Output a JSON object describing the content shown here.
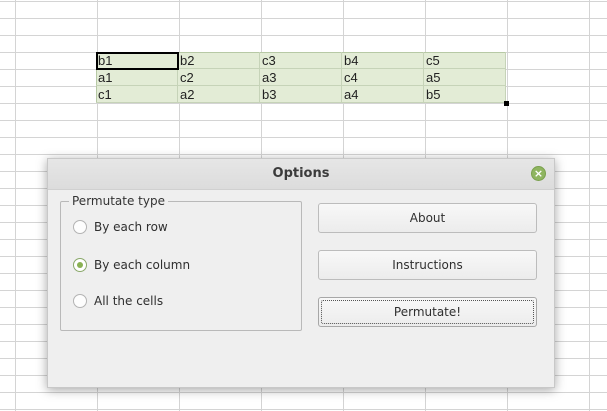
{
  "spreadsheet": {
    "rows": [
      [
        "b1",
        "b2",
        "c3",
        "b4",
        "c5"
      ],
      [
        "a1",
        "c2",
        "a3",
        "c4",
        "a5"
      ],
      [
        "c1",
        "a2",
        "b3",
        "a4",
        "b5"
      ]
    ]
  },
  "dialog": {
    "title": "Options",
    "group_title": "Permutate type",
    "options": [
      {
        "label": "By each row",
        "checked": false
      },
      {
        "label": "By each column",
        "checked": true
      },
      {
        "label": "All the cells",
        "checked": false
      }
    ],
    "buttons": {
      "about": "About",
      "instructions": "Instructions",
      "permutate": "Permutate!"
    },
    "close_icon": "×"
  },
  "colors": {
    "selection": "#e3ecd6",
    "accent": "#89b152"
  }
}
